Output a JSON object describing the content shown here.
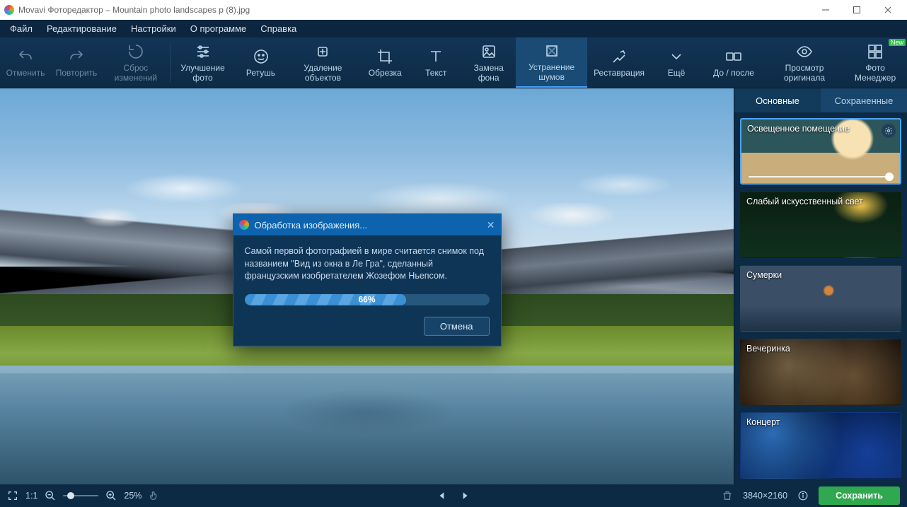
{
  "titlebar": {
    "text": "Movavi Фоторедактор – Mountain photo landscapes p (8).jpg"
  },
  "menu": {
    "file": "Файл",
    "edit": "Редактирование",
    "settings": "Настройки",
    "about": "О программе",
    "help": "Справка"
  },
  "toolbar": {
    "undo": "Отменить",
    "redo": "Повторить",
    "reset": "Сброс изменений",
    "enhance": "Улучшение фото",
    "retouch": "Ретушь",
    "remove": "Удаление объектов",
    "crop": "Обрезка",
    "text": "Текст",
    "bg": "Замена фона",
    "noise": "Устранение шумов",
    "restore": "Реставрация",
    "more": "Ещё",
    "beforeafter": "До / после",
    "vieworig": "Просмотр оригинала",
    "manager": "Фото Менеджер",
    "new_badge": "New"
  },
  "tabs": {
    "main": "Основные",
    "saved": "Сохраненные"
  },
  "presets": [
    {
      "label": "Освещенное помещение",
      "selected": true,
      "gear": true,
      "slider": true,
      "bg": "bg-room"
    },
    {
      "label": "Слабый искусственный свет",
      "bg": "bg-lamp"
    },
    {
      "label": "Сумерки",
      "bg": "bg-dusk"
    },
    {
      "label": "Вечеринка",
      "bg": "bg-party"
    },
    {
      "label": "Концерт",
      "bg": "bg-concert"
    }
  ],
  "dialog": {
    "title": "Обработка изображения...",
    "fact": "Самой первой фотографией в мире считается снимок под названием \"Вид из окна в Ле Гра\", сделанный французским изобретателем Жозефом Ньепсом.",
    "progress_pct": "66%",
    "cancel": "Отмена"
  },
  "footer": {
    "fit": "1:1",
    "zoom": "25%",
    "dims": "3840×2160",
    "save": "Сохранить"
  }
}
